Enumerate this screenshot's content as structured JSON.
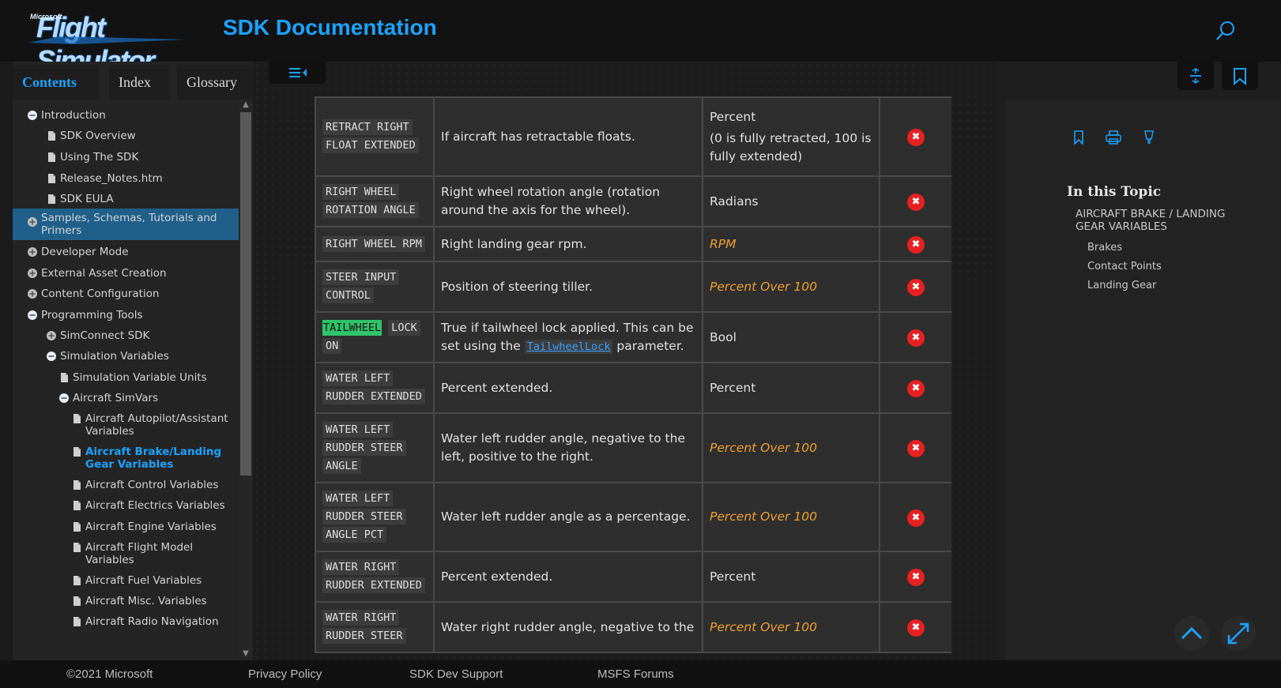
{
  "header": {
    "logo_small": "Microsoft",
    "logo_text": "Flight Simulator",
    "title": "SDK Documentation",
    "search_icon": "search-icon"
  },
  "left_tabs": [
    {
      "label": "Contents",
      "active": true
    },
    {
      "label": "Index",
      "active": false
    },
    {
      "label": "Glossary",
      "active": false
    }
  ],
  "tree": [
    {
      "label": "Introduction",
      "icon": "collapse",
      "level": 0
    },
    {
      "label": "SDK Overview",
      "icon": "page",
      "level": 1
    },
    {
      "label": "Using The SDK",
      "icon": "page",
      "level": 1
    },
    {
      "label": "Release_Notes.htm",
      "icon": "page",
      "level": 1
    },
    {
      "label": "SDK EULA",
      "icon": "page",
      "level": 1
    },
    {
      "label": "Samples, Schemas, Tutorials and Primers",
      "icon": "expand",
      "level": 0,
      "selected": true
    },
    {
      "label": "Developer Mode",
      "icon": "expand",
      "level": 0
    },
    {
      "label": "External Asset Creation",
      "icon": "expand",
      "level": 0
    },
    {
      "label": "Content Configuration",
      "icon": "expand",
      "level": 0
    },
    {
      "label": "Programming Tools",
      "icon": "collapse",
      "level": 0
    },
    {
      "label": "SimConnect SDK",
      "icon": "expand",
      "level": 1
    },
    {
      "label": "Simulation Variables",
      "icon": "collapse",
      "level": 1
    },
    {
      "label": "Simulation Variable Units",
      "icon": "page",
      "level": 2
    },
    {
      "label": "Aircraft SimVars",
      "icon": "collapse",
      "level": 2
    },
    {
      "label": "Aircraft Autopilot/Assistant Variables",
      "icon": "page",
      "level": 3
    },
    {
      "label": "Aircraft Brake/Landing Gear Variables",
      "icon": "page",
      "level": 3,
      "current": true
    },
    {
      "label": "Aircraft Control Variables",
      "icon": "page",
      "level": 3
    },
    {
      "label": "Aircraft Electrics Variables",
      "icon": "page",
      "level": 3
    },
    {
      "label": "Aircraft Engine Variables",
      "icon": "page",
      "level": 3
    },
    {
      "label": "Aircraft Flight Model Variables",
      "icon": "page",
      "level": 3
    },
    {
      "label": "Aircraft Fuel Variables",
      "icon": "page",
      "level": 3
    },
    {
      "label": "Aircraft Misc. Variables",
      "icon": "page",
      "level": 3
    },
    {
      "label": "Aircraft Radio Navigation",
      "icon": "page",
      "level": 3
    }
  ],
  "table_rows": [
    {
      "name": [
        "RETRACT RIGHT",
        "FLOAT EXTENDED"
      ],
      "desc": "If aircraft has retractable floats.",
      "units": "Percent\n(0 is fully retracted, 100 is fully extended)",
      "unit_link": false,
      "settable": "no"
    },
    {
      "name": [
        "RIGHT WHEEL",
        "ROTATION ANGLE"
      ],
      "desc": "Right wheel rotation angle (rotation around the axis for the wheel).",
      "units": "Radians",
      "unit_link": false,
      "settable": "no"
    },
    {
      "name": [
        "RIGHT WHEEL RPM"
      ],
      "desc": "Right landing gear rpm.",
      "units": "RPM",
      "unit_link": true,
      "settable": "no"
    },
    {
      "name": [
        "STEER INPUT",
        "CONTROL"
      ],
      "desc": "Position of steering tiller.",
      "units": "Percent Over 100",
      "unit_link": true,
      "settable": "no"
    },
    {
      "name": [
        "TAILWHEEL",
        "LOCK",
        "ON"
      ],
      "desc_pre": "True if tailwheel lock applied. This can be set using the ",
      "desc_link": "TailwheelLock",
      "desc_post": " parameter.",
      "units": "Bool",
      "unit_link": false,
      "settable": "no",
      "highlight": "TAILWHEEL"
    },
    {
      "name": [
        "WATER LEFT",
        "RUDDER EXTENDED"
      ],
      "desc": "Percent extended.",
      "units": "Percent",
      "unit_link": false,
      "settable": "no"
    },
    {
      "name": [
        "WATER LEFT",
        "RUDDER STEER",
        "ANGLE"
      ],
      "desc": "Water left rudder angle, negative to the left, positive to the right.",
      "units": "Percent Over 100",
      "unit_link": true,
      "settable": "no"
    },
    {
      "name": [
        "WATER LEFT",
        "RUDDER STEER",
        "ANGLE PCT"
      ],
      "desc": "Water left rudder angle as a percentage.",
      "units": "Percent Over 100",
      "unit_link": true,
      "settable": "no"
    },
    {
      "name": [
        "WATER RIGHT",
        "RUDDER EXTENDED"
      ],
      "desc": "Percent extended.",
      "units": "Percent",
      "unit_link": false,
      "settable": "no"
    },
    {
      "name": [
        "WATER RIGHT",
        "RUDDER STEER"
      ],
      "desc": "Water right rudder angle, negative to the",
      "units": "Percent Over 100",
      "unit_link": true,
      "settable": "no"
    }
  ],
  "right_panel": {
    "toc_title": "In this Topic",
    "toc_main": "AIRCRAFT BRAKE / LANDING GEAR VARIABLES",
    "toc_items": [
      "Brakes",
      "Contact Points",
      "Landing Gear"
    ]
  },
  "footer": {
    "copyright": "©2021 Microsoft",
    "privacy": "Privacy Policy",
    "support": "SDK Dev Support",
    "forums": "MSFS Forums"
  },
  "colors": {
    "accent": "#1aa3ff",
    "unit_link": "#f0a030",
    "no_icon": "#e82020",
    "highlight": "#2ec46a"
  }
}
